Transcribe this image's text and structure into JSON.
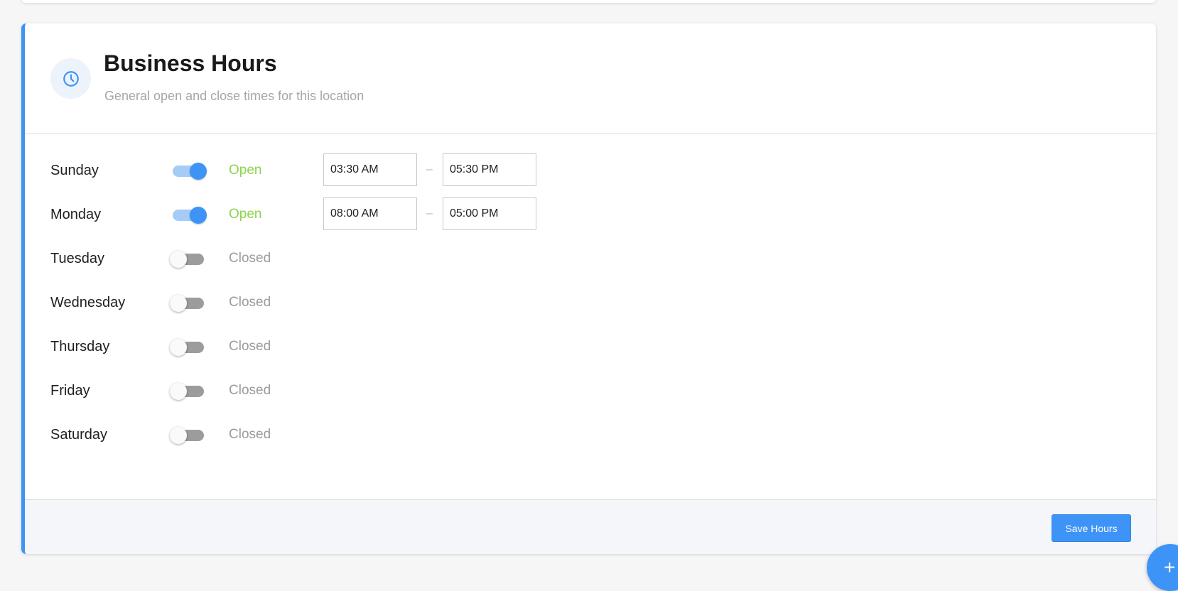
{
  "header": {
    "title": "Business Hours",
    "subtitle": "General open and close times for this location",
    "icon": "clock-icon"
  },
  "days": [
    {
      "name": "Sunday",
      "open": true,
      "status": "Open",
      "open_time": "03:30 AM",
      "close_time": "05:30 PM"
    },
    {
      "name": "Monday",
      "open": true,
      "status": "Open",
      "open_time": "08:00 AM",
      "close_time": "05:00 PM"
    },
    {
      "name": "Tuesday",
      "open": false,
      "status": "Closed"
    },
    {
      "name": "Wednesday",
      "open": false,
      "status": "Closed"
    },
    {
      "name": "Thursday",
      "open": false,
      "status": "Closed"
    },
    {
      "name": "Friday",
      "open": false,
      "status": "Closed"
    },
    {
      "name": "Saturday",
      "open": false,
      "status": "Closed"
    }
  ],
  "separator": "–",
  "footer": {
    "save_label": "Save Hours"
  },
  "fab": {
    "label": "+"
  },
  "colors": {
    "accent": "#3d94f6",
    "open_status": "#8bd44a",
    "closed_status": "#9c9c9e"
  }
}
